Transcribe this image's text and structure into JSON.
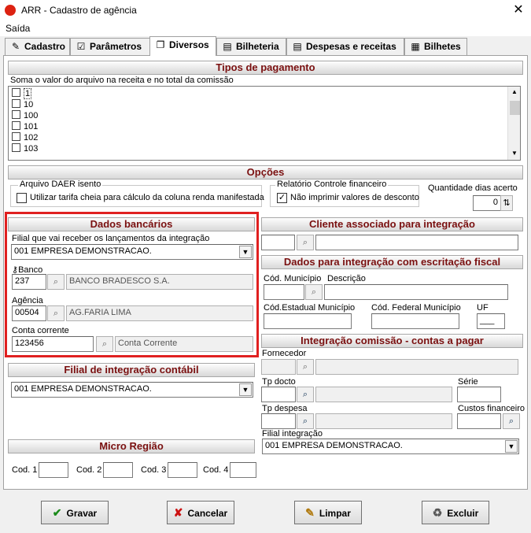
{
  "window": {
    "title": "ARR - Cadastro de agência",
    "close": "✕",
    "menu": "Saída"
  },
  "tabs": [
    {
      "icon": "✎",
      "label": "Cadastro"
    },
    {
      "icon": "☑",
      "label": "Parâmetros"
    },
    {
      "icon": "❐",
      "label": "Diversos"
    },
    {
      "icon": "▤",
      "label": "Bilheteria"
    },
    {
      "icon": "▤",
      "label": "Despesas e receitas"
    },
    {
      "icon": "▦",
      "label": "Bilhetes"
    }
  ],
  "tipos": {
    "title": "Tipos de pagamento",
    "note": "Soma o valor do arquivo na receita e no total da comissão",
    "items": [
      "1",
      "10",
      "100",
      "101",
      "102",
      "103"
    ]
  },
  "opcoes": {
    "title": "Opções",
    "daer_title": "Arquivo DAER isento",
    "daer_check": "Utilizar tarifa cheia para cálculo da coluna renda  manifestada",
    "rel_title": "Relatório Controle financeiro",
    "rel_check": "Não imprimir valores de desconto",
    "qtd_label": "Quantidade dias acerto",
    "qtd_value": "0"
  },
  "bancarios": {
    "title": "Dados bancários",
    "filial_label": "Filial que vai receber os lançamentos da integração",
    "filial_value": "001 EMPRESA DEMONSTRACAO.",
    "banco_label": "Banco",
    "banco_code": "237",
    "banco_name": "BANCO BRADESCO S.A.",
    "agencia_label": "Agência",
    "agencia_code": "00504",
    "agencia_name": "AG.FARIA LIMA",
    "conta_label": "Conta corrente",
    "conta_value": "123456",
    "conta_desc": "Conta Corrente"
  },
  "cliente": {
    "title": "Cliente associado para integração"
  },
  "fiscal": {
    "title": "Dados para integração com escritação fiscal",
    "cod_mun": "Cód. Município",
    "descricao": "Descrição",
    "cod_est": "Cód.Estadual Município",
    "cod_fed": "Cód. Federal Município",
    "uf": "UF",
    "uf_value": "___"
  },
  "contabil": {
    "title": "Filial de integração contábil",
    "value": "001 EMPRESA DEMONSTRACAO."
  },
  "comissao": {
    "title": "Integração comissão - contas a pagar",
    "fornecedor": "Fornecedor",
    "tp_docto": "Tp docto",
    "serie": "Série",
    "tp_despesa": "Tp despesa",
    "custos": "Custos financeiro",
    "filial": "Filial integração",
    "filial_value": "001 EMPRESA DEMONSTRACAO."
  },
  "micro": {
    "title": "Micro Região",
    "cod1": "Cod. 1",
    "cod2": "Cod. 2",
    "cod3": "Cod. 3",
    "cod4": "Cod. 4"
  },
  "buttons": {
    "gravar": "Gravar",
    "cancelar": "Cancelar",
    "limpar": "Limpar",
    "excluir": "Excluir"
  },
  "colors": {
    "header_text": "#7a1010",
    "highlight": "#e02020"
  }
}
